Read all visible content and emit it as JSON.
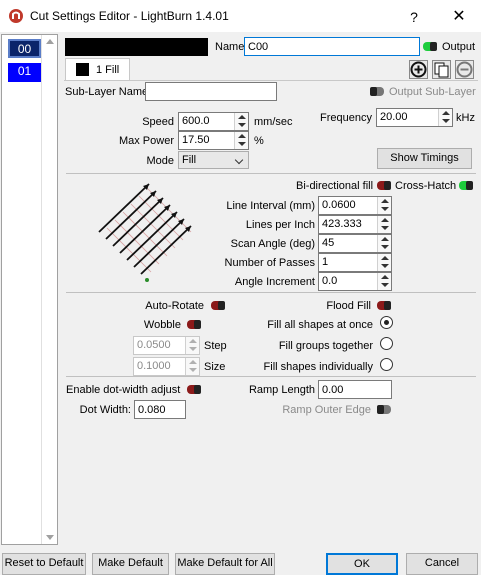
{
  "window": {
    "title": "Cut Settings Editor - LightBurn 1.4.01",
    "help_label": "?",
    "close_label": "✕"
  },
  "layers": [
    {
      "label": "00",
      "color": "#0a246a"
    },
    {
      "label": "01",
      "color": "#0000ff"
    }
  ],
  "header": {
    "layer_color": "#000000",
    "name_label": "Name",
    "name_value": "C00",
    "output_label": "Output",
    "output_on": true
  },
  "tabs": [
    {
      "label": "1 Fill",
      "color": "#000000"
    }
  ],
  "toolbar_icons": [
    "add-icon",
    "copy-icon",
    "remove-icon"
  ],
  "sublayer": {
    "label": "Sub-Layer Name",
    "value": "",
    "output_label": "Output Sub-Layer",
    "output_on": false
  },
  "speed": {
    "label": "Speed",
    "value": "600.0",
    "unit": "mm/sec"
  },
  "max_power": {
    "label": "Max Power",
    "value": "17.50",
    "unit": "%"
  },
  "mode": {
    "label": "Mode",
    "value": "Fill"
  },
  "frequency": {
    "label": "Frequency",
    "value": "20.00",
    "unit": "kHz"
  },
  "show_timings_label": "Show Timings",
  "fill": {
    "bidirectional_label": "Bi-directional fill",
    "bidirectional_on": false,
    "crosshatch_label": "Cross-Hatch",
    "crosshatch_on": true,
    "line_interval": {
      "label": "Line Interval (mm)",
      "value": "0.0600"
    },
    "lines_per_inch": {
      "label": "Lines per Inch",
      "value": "423.333"
    },
    "scan_angle": {
      "label": "Scan Angle (deg)",
      "value": "45"
    },
    "num_passes": {
      "label": "Number of Passes",
      "value": "1"
    },
    "angle_increment": {
      "label": "Angle Increment",
      "value": "0.0"
    }
  },
  "options": {
    "auto_rotate_label": "Auto-Rotate",
    "auto_rotate_on": false,
    "flood_fill_label": "Flood Fill",
    "flood_fill_on": false,
    "wobble_label": "Wobble",
    "wobble_on": false,
    "step_value": "0.0500",
    "step_label": "Step",
    "size_value": "0.1000",
    "size_label": "Size",
    "fill_all_label": "Fill all shapes at once",
    "fill_groups_label": "Fill groups together",
    "fill_individually_label": "Fill shapes individually",
    "fill_selected": "all"
  },
  "dot": {
    "enable_label": "Enable dot-width adjust",
    "enable_on": false,
    "width_label": "Dot Width:",
    "width_value": "0.080"
  },
  "ramp": {
    "length_label": "Ramp Length",
    "length_value": "0.00",
    "outer_edge_label": "Ramp Outer Edge",
    "outer_edge_on": false
  },
  "buttons": {
    "reset": "Reset to Default",
    "make_default": "Make Default",
    "make_default_all": "Make Default for All",
    "ok": "OK",
    "cancel": "Cancel"
  }
}
